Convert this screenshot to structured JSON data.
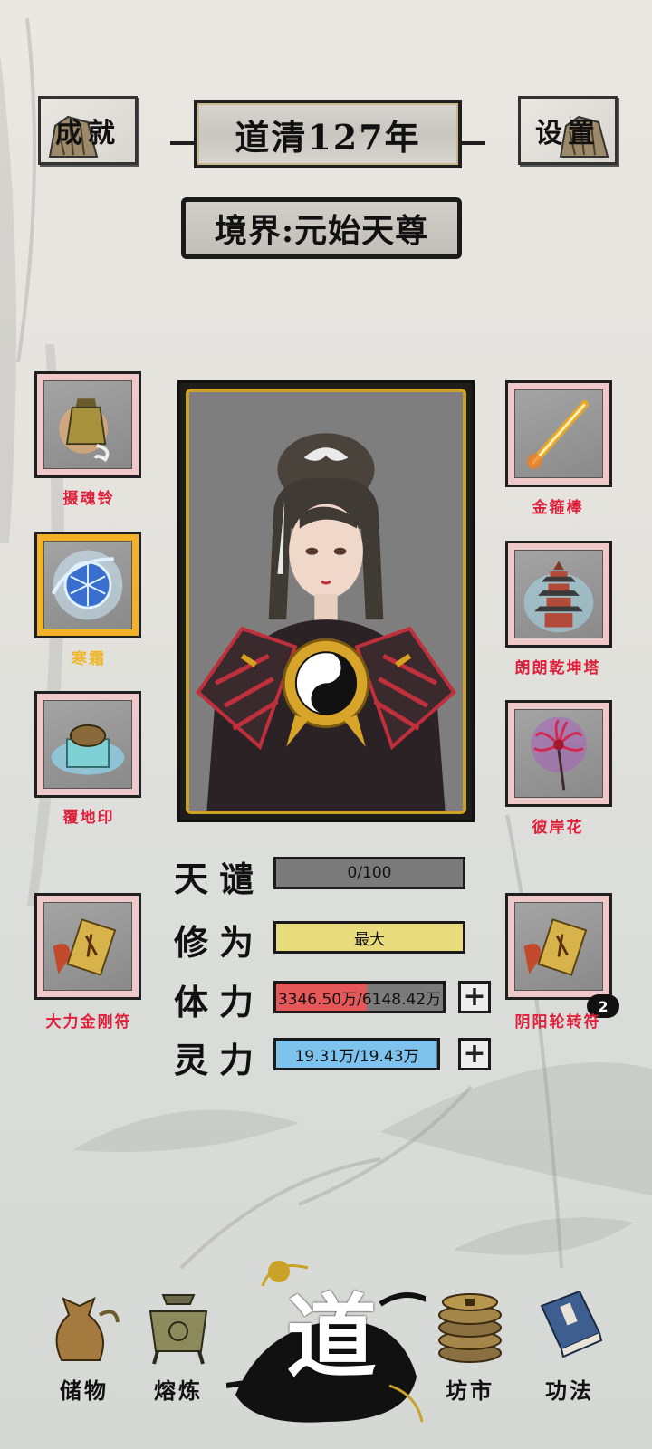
{
  "header": {
    "achievements_label": "成就",
    "settings_label": "设置",
    "year_title": "道清127年",
    "realm_title": "境界:元始天尊"
  },
  "equipment_left": [
    {
      "label": "摄魂铃",
      "icon": "bell-icon",
      "highlight": false
    },
    {
      "label": "寒霜",
      "icon": "frost-orb-icon",
      "highlight": true
    },
    {
      "label": "覆地印",
      "icon": "turtle-seal-icon",
      "highlight": false
    },
    {
      "label": "大力金刚符",
      "icon": "talisman-scroll-icon",
      "highlight": false
    }
  ],
  "equipment_right": [
    {
      "label": "金箍棒",
      "icon": "golden-staff-icon",
      "highlight": false
    },
    {
      "label": "朗朗乾坤塔",
      "icon": "pagoda-icon",
      "highlight": false
    },
    {
      "label": "彼岸花",
      "icon": "red-spider-lily-icon",
      "highlight": false
    },
    {
      "label": "阴阳轮转符",
      "icon": "talisman-scroll-icon",
      "highlight": false,
      "badge": "2"
    }
  ],
  "stats": {
    "tribulation": {
      "label": "天谴",
      "value": "0/100",
      "fraction": 0.0
    },
    "cultivation": {
      "label": "修为",
      "value": "最大",
      "fraction": 1.0
    },
    "stamina": {
      "label": "体力",
      "value": "3346.50万/6148.42万",
      "fraction": 0.544
    },
    "spirit": {
      "label": "灵力",
      "value": "19.31万/19.43万",
      "fraction": 0.994
    }
  },
  "nav": {
    "storage": "储物",
    "forge": "熔炼",
    "center": "道",
    "market": "坊市",
    "techniques": "功法"
  },
  "colors": {
    "slot_border": "#efc9c9",
    "slot_highlight": "#f3b12a",
    "label_red": "#e0203b",
    "label_gold": "#f0b62a",
    "cultivation_fill": "#e9dc7d",
    "stamina_fill": "#e4585a",
    "spirit_fill": "#7ec3ee",
    "portrait_border": "#c9a227"
  }
}
